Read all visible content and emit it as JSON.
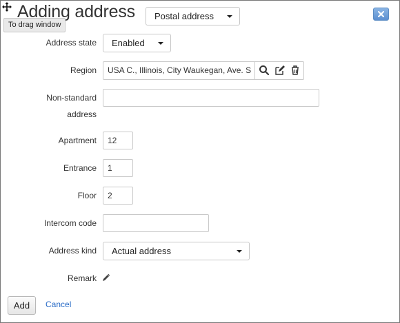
{
  "dialog": {
    "title": "Adding address",
    "address_type": "Postal address",
    "drag_tooltip": "To drag window"
  },
  "form": {
    "address_state": {
      "label": "Address state",
      "value": "Enabled"
    },
    "region": {
      "label": "Region",
      "value": "USA C., Illinois, City Waukegan, Ave. S"
    },
    "non_standard_address": {
      "label_line1": "Non-standard",
      "label_line2": "address",
      "value": ""
    },
    "apartment": {
      "label": "Apartment",
      "value": "12"
    },
    "entrance": {
      "label": "Entrance",
      "value": "1"
    },
    "floor": {
      "label": "Floor",
      "value": "2"
    },
    "intercom_code": {
      "label": "Intercom code",
      "value": ""
    },
    "address_kind": {
      "label": "Address kind",
      "value": "Actual address"
    },
    "remark": {
      "label": "Remark"
    }
  },
  "footer": {
    "add_label": "Add",
    "cancel_label": "Cancel"
  },
  "icons": {
    "drag": "move-icon",
    "close": "close-icon",
    "search": "search-icon",
    "edit": "edit-icon",
    "delete": "trash-icon",
    "remark": "pencil-icon"
  },
  "colors": {
    "accent": "#2a6cc7",
    "close_button": "#5b8fd0"
  }
}
